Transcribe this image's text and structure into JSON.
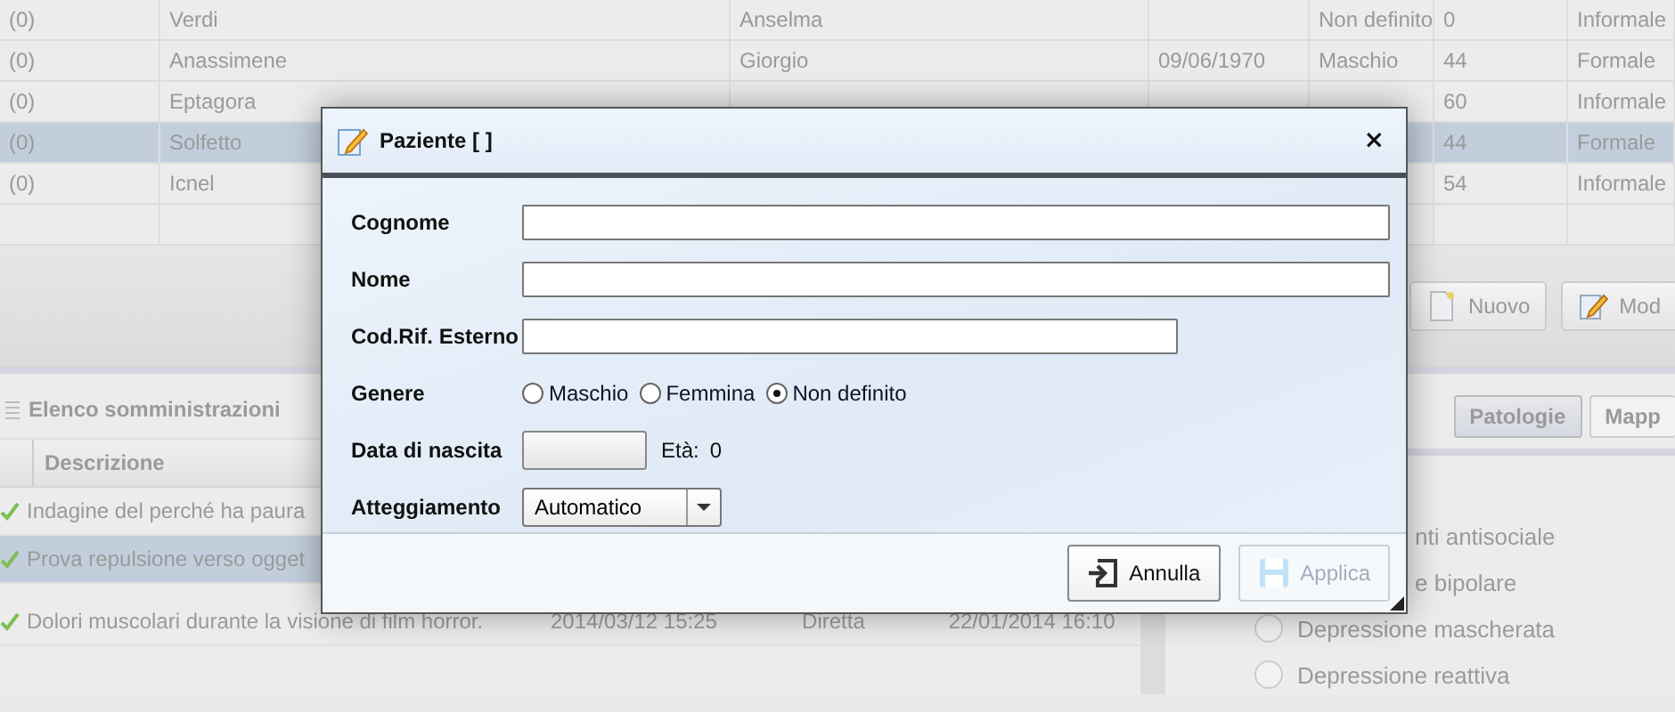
{
  "patients_table": {
    "rows": [
      {
        "code": "(0)",
        "surname": "Verdi",
        "name": "Anselma",
        "gender": "Non definito",
        "age": "0",
        "type": "Informale",
        "selected": false
      },
      {
        "code": "(0)",
        "surname": "Anassimene",
        "name": "Giorgio",
        "birth_date": "09/06/1970",
        "gender": "Maschio",
        "age": "44",
        "type": "Formale",
        "selected": false
      },
      {
        "code": "(0)",
        "surname": "Eptagora",
        "age": "60",
        "type": "Informale",
        "selected": false
      },
      {
        "code": "(0)",
        "surname": "Solfetto",
        "age": "44",
        "type": "Formale",
        "selected": true
      },
      {
        "code": "(0)",
        "surname": "Icnel",
        "age": "54",
        "type": "Informale",
        "selected": false
      }
    ]
  },
  "toolbar": {
    "buttons": [
      {
        "label": "Nuovo",
        "kind": "new"
      },
      {
        "label": "Mod",
        "kind": "edit"
      }
    ]
  },
  "administrations": {
    "title": "Elenco somministrazioni",
    "columns": [
      "Descrizione"
    ],
    "rows": [
      {
        "description": "Indagine del perché ha paura",
        "done": true,
        "selected": false
      },
      {
        "description": "Prova repulsione verso ogget",
        "done": true,
        "selected": true
      },
      {
        "description": "Dolori muscolari durante la visione di film horror.",
        "date": "2014/03/12 15:25",
        "mode": "Diretta",
        "date_2": "22/01/2014 16:10",
        "done": true,
        "selected": false
      }
    ]
  },
  "pathologies": {
    "tabs": [
      {
        "label": "Patologie",
        "selected": true
      },
      {
        "label": "Mapp",
        "selected": false
      }
    ],
    "items": [
      {
        "label": "nti antisociale",
        "kind": "cut"
      },
      {
        "label": "e bipolare",
        "kind": "cut"
      },
      {
        "label": "Depressione mascherata",
        "kind": "radio",
        "selected": false
      },
      {
        "label": "Depressione reattiva",
        "kind": "radio",
        "selected": false
      }
    ]
  },
  "dialog": {
    "title": "Paziente [ ]",
    "close": "×",
    "fields": [
      {
        "kind": "text",
        "label": "Cognome"
      },
      {
        "kind": "text",
        "label": "Nome"
      },
      {
        "kind": "text",
        "label": "Cod.Rif. Esterno"
      },
      {
        "kind": "radio",
        "label": "Genere",
        "options": [
          {
            "label": "Maschio",
            "selected": false
          },
          {
            "label": "Femmina",
            "selected": false
          },
          {
            "label": "Non definito",
            "selected": true
          }
        ]
      },
      {
        "kind": "date",
        "label": "Data di nascita",
        "age_label": "Età:",
        "age": "0"
      },
      {
        "kind": "select",
        "label": "Atteggiamento",
        "value": "Automatico"
      }
    ],
    "buttons": [
      {
        "label": "Annulla",
        "kind": "exit",
        "disabled": false
      },
      {
        "label": "Applica",
        "kind": "save",
        "disabled": true
      }
    ]
  }
}
